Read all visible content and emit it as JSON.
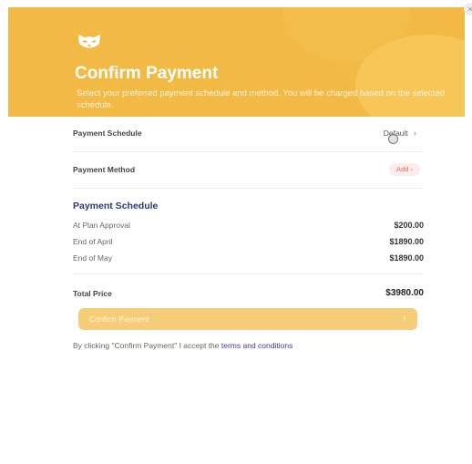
{
  "header": {
    "title": "Confirm Payment",
    "subtitle": "Select your preferred payment schedule and method. You will be charged based on the selected schedule."
  },
  "payment_schedule_row": {
    "label": "Payment Schedule",
    "value": "Default"
  },
  "payment_method_row": {
    "label": "Payment Method",
    "action": "Add"
  },
  "schedule": {
    "title": "Payment Schedule",
    "items": [
      {
        "label": "At Plan Approval",
        "amount": "$200.00"
      },
      {
        "label": "End of April",
        "amount": "$1890.00"
      },
      {
        "label": "End of May",
        "amount": "$1890.00"
      }
    ]
  },
  "total": {
    "label": "Total Price",
    "value": "$3980.00"
  },
  "confirm_button": {
    "label": "Confirm Payment"
  },
  "terms": {
    "prefix": "By clicking \"Confirm Payment\" I accept the",
    "link": "terms and conditions"
  },
  "colors": {
    "header": "#f2b945",
    "button": "#f5cd78",
    "accent": "#2f3770",
    "add_pill_text": "#f06a5a"
  },
  "icons": {
    "logo": "raccoon-logo-icon",
    "chevron": "chevron-right-icon"
  }
}
